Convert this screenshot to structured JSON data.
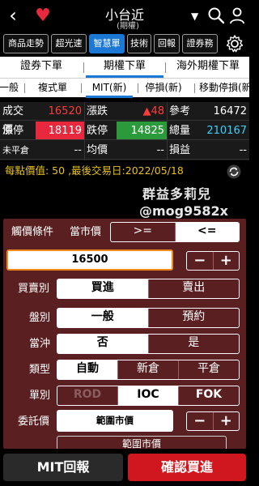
{
  "topbar": {
    "title": "小台近",
    "subtitle": "(期權) ",
    "dropdown_glyph": "▼"
  },
  "tools": [
    "商品走勢",
    "超光速",
    "智慧單",
    "技術",
    "回報",
    "證券務"
  ],
  "order_tabs": [
    "證券下單",
    "期權下單",
    "海外期權下單"
  ],
  "sub_tabs": [
    "一般",
    "複式單",
    "MIT(新)",
    "停損(新)",
    "移動停損(新)"
  ],
  "quote": {
    "row1": {
      "l1": "成交價",
      "v1": "16520",
      "l2": "漲跌",
      "v2": "▲48",
      "l3": "參考",
      "v3": "16472"
    },
    "row2": {
      "l1": "漲停",
      "v1": "18119",
      "l2": "跌停",
      "v2": "14825",
      "l3": "總量",
      "v3": "210167"
    },
    "row3": {
      "l1": "未平倉",
      "v1": "--",
      "l2": "均價",
      "v2": "--",
      "l3": "損益",
      "v3": "--"
    }
  },
  "info_line": "每點價值: 50 ,最後交易日:2022/05/18",
  "watermark": {
    "line1": "群益多莉兒",
    "line2": "@mog9582x"
  },
  "panel": {
    "trigger_label": "觸價條件",
    "trigger_value": "當市價",
    "trigger_ops": [
      ">=",
      "<="
    ],
    "price": "16500",
    "stepper": [
      "−",
      "+"
    ],
    "side_label": "買賣別",
    "side_opts": [
      "買進",
      "賣出"
    ],
    "session_label": "盤別",
    "session_opts": [
      "一般",
      "預約"
    ],
    "daytrade_label": "當沖",
    "daytrade_opts": [
      "否",
      "是"
    ],
    "type_label": "類型",
    "type_opts": [
      "自動",
      "新倉",
      "平倉"
    ],
    "order_type_label": "單別",
    "order_type_opts": [
      "ROD",
      "IOC",
      "FOK"
    ],
    "delegate_label": "委託價",
    "delegate_value": "範圍市價",
    "peek_value": "範圍市價"
  },
  "buttons": {
    "mit": "MIT回報",
    "confirm_buy": "確認買進"
  },
  "colors": {
    "accent_blue": "#1b78d4",
    "up_red": "#ff3b3b",
    "panel_bg": "#5a1f21",
    "buy_red": "#d0171f",
    "info_yellow": "#e8c21a"
  }
}
